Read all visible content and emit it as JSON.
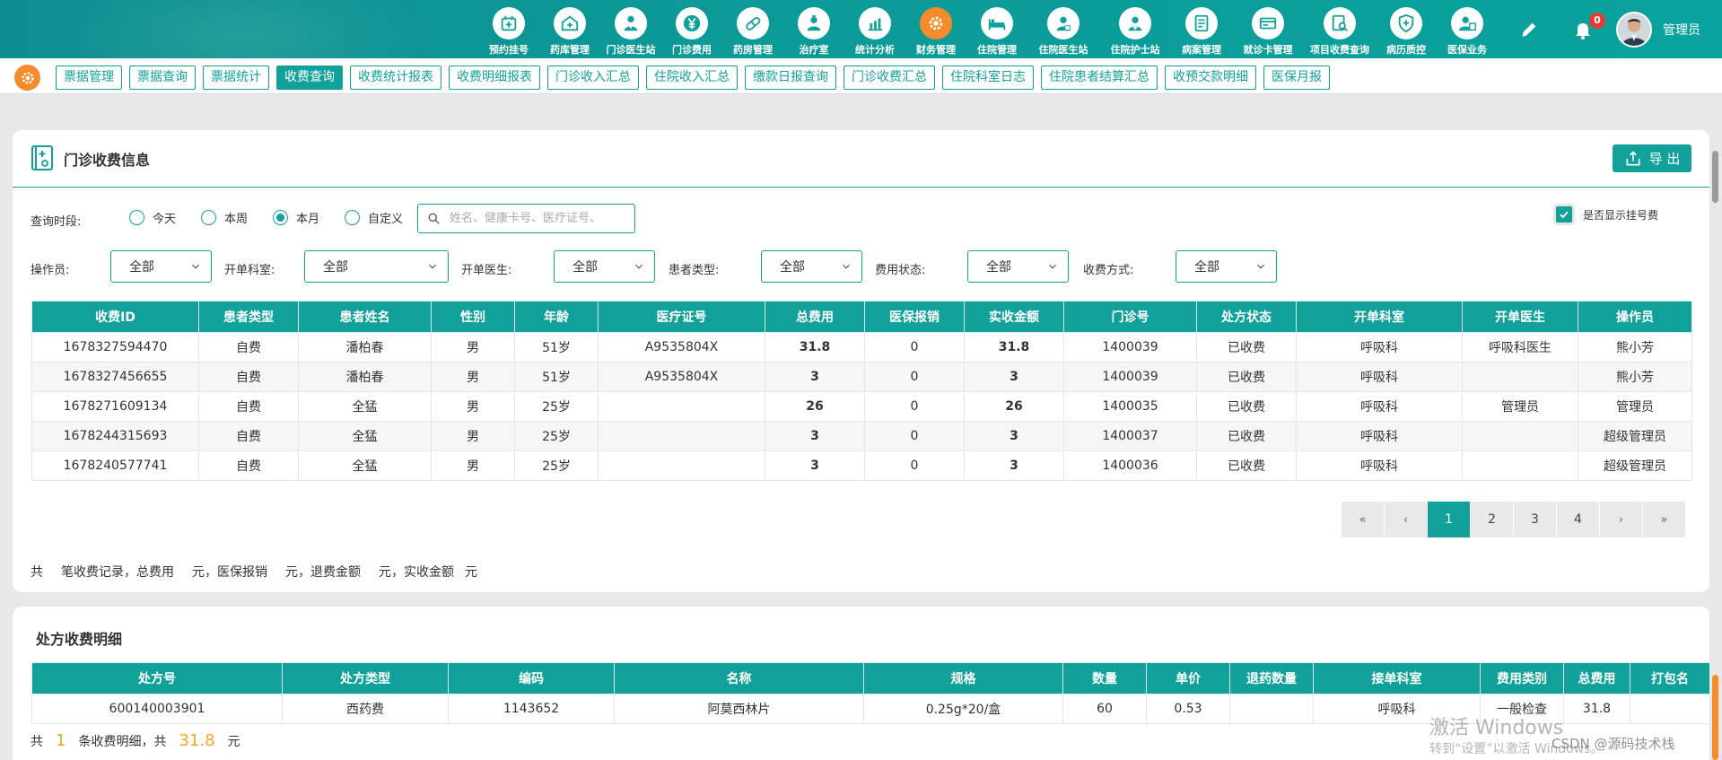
{
  "topnav": {
    "items": [
      {
        "label": "预约挂号",
        "icon": "calendar-icon"
      },
      {
        "label": "药库管理",
        "icon": "warehouse-icon"
      },
      {
        "label": "门诊医生站",
        "icon": "doctor-icon"
      },
      {
        "label": "门诊费用",
        "icon": "yuan-icon"
      },
      {
        "label": "药房管理",
        "icon": "pill-icon"
      },
      {
        "label": "治疗室",
        "icon": "nurse-icon"
      },
      {
        "label": "统计分析",
        "icon": "chart-icon"
      },
      {
        "label": "财务管理",
        "icon": "gear-icon",
        "active": true
      },
      {
        "label": "住院管理",
        "icon": "bed-icon"
      },
      {
        "label": "住院医生站",
        "icon": "doctor-card-icon"
      },
      {
        "label": "住院护士站",
        "icon": "nurse-card-icon"
      },
      {
        "label": "病案管理",
        "icon": "record-icon"
      },
      {
        "label": "就诊卡管理",
        "icon": "id-card-icon"
      },
      {
        "label": "项目收费查询",
        "icon": "search-doc-icon"
      },
      {
        "label": "病历质控",
        "icon": "shield-icon"
      },
      {
        "label": "医保业务",
        "icon": "insurance-icon"
      }
    ],
    "notification_count": "0",
    "user_name": "管理员"
  },
  "subtabs": [
    {
      "label": "票据管理"
    },
    {
      "label": "票据查询"
    },
    {
      "label": "票据统计"
    },
    {
      "label": "收费查询",
      "active": true
    },
    {
      "label": "收费统计报表"
    },
    {
      "label": "收费明细报表"
    },
    {
      "label": "门诊收入汇总"
    },
    {
      "label": "住院收入汇总"
    },
    {
      "label": "缴款日报查询"
    },
    {
      "label": "门诊收费汇总"
    },
    {
      "label": "住院科室日志"
    },
    {
      "label": "住院患者结算汇总"
    },
    {
      "label": "收预交款明细"
    },
    {
      "label": "医保月报"
    }
  ],
  "outpatient": {
    "title": "门诊收费信息",
    "export_label": "导 出",
    "period_label": "查询时段:",
    "periods": [
      "今天",
      "本周",
      "本月",
      "自定义"
    ],
    "period_selected": "本月",
    "search_placeholder": "姓名、健康卡号、医疗证号、",
    "show_reg_fee_label": "是否显示挂号费",
    "filters": [
      {
        "label": "操作员:",
        "value": "全部"
      },
      {
        "label": "开单科室:",
        "value": "全部"
      },
      {
        "label": "开单医生:",
        "value": "全部"
      },
      {
        "label": "患者类型:",
        "value": "全部"
      },
      {
        "label": "费用状态:",
        "value": "全部"
      },
      {
        "label": "收费方式:",
        "value": "全部"
      }
    ],
    "columns": [
      "收费ID",
      "患者类型",
      "患者姓名",
      "性别",
      "年龄",
      "医疗证号",
      "总费用",
      "医保报销",
      "实收金额",
      "门诊号",
      "处方状态",
      "开单科室",
      "开单医生",
      "操作员"
    ],
    "rows": [
      [
        "1678327594470",
        "自费",
        "潘柏春",
        "男",
        "51岁",
        "A9535804X",
        "31.8",
        "0",
        "31.8",
        "1400039",
        "已收费",
        "呼吸科",
        "呼吸科医生",
        "熊小芳"
      ],
      [
        "1678327456655",
        "自费",
        "潘柏春",
        "男",
        "51岁",
        "A9535804X",
        "3",
        "0",
        "3",
        "1400039",
        "已收费",
        "呼吸科",
        "",
        "熊小芳"
      ],
      [
        "1678271609134",
        "自费",
        "全猛",
        "男",
        "25岁",
        "",
        "26",
        "0",
        "26",
        "1400035",
        "已收费",
        "呼吸科",
        "管理员",
        "管理员"
      ],
      [
        "1678244315693",
        "自费",
        "全猛",
        "男",
        "25岁",
        "",
        "3",
        "0",
        "3",
        "1400037",
        "已收费",
        "呼吸科",
        "",
        "超级管理员"
      ],
      [
        "1678240577741",
        "自费",
        "全猛",
        "男",
        "25岁",
        "",
        "3",
        "0",
        "3",
        "1400036",
        "已收费",
        "呼吸科",
        "",
        "超级管理员"
      ]
    ],
    "pagination": {
      "first": "«",
      "prev": "‹",
      "pages": [
        "1",
        "2",
        "3",
        "4"
      ],
      "current": "1",
      "next": "›",
      "last": "»"
    },
    "summary": {
      "p1": "共",
      "p2": "笔收费记录，总费用",
      "p3": "元，医保报销",
      "p4": "元，退费金额",
      "p5": "元，实收金额",
      "p6": "元"
    }
  },
  "prescription": {
    "title": "处方收费明细",
    "columns": [
      "处方号",
      "处方类型",
      "编码",
      "名称",
      "规格",
      "数量",
      "单价",
      "退药数量",
      "接单科室",
      "费用类别",
      "总费用",
      "打包名"
    ],
    "rows": [
      [
        "600140003901",
        "西药费",
        "1143652",
        "阿莫西林片",
        "0.25g*20/盒",
        "60",
        "0.53",
        "",
        "呼吸科",
        "一般检查",
        "31.8",
        ""
      ]
    ],
    "summary": {
      "p1": "共",
      "count": "1",
      "p2": "条收费明细，共",
      "total": "31.8",
      "p3": "元"
    }
  },
  "watermark": {
    "line1": "激活 Windows",
    "line2": "转到“设置”以激活 Windows。",
    "source": "CSDN @源码技术栈"
  },
  "colors": {
    "primary": "#12a19a",
    "accent": "#f58b2a",
    "badge": "#e53935",
    "paid": "#3aa14c",
    "amount": "#f5a623"
  }
}
